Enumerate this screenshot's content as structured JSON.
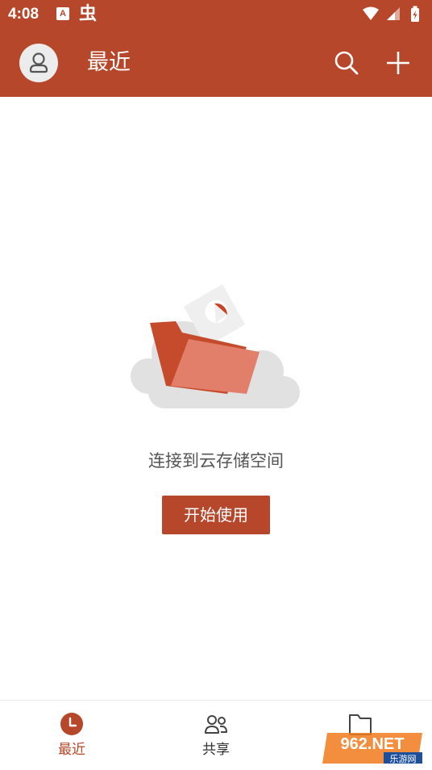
{
  "status_bar": {
    "time": "4:08",
    "notification_icons": [
      "a-icon",
      "bug-icon"
    ],
    "a_glyph": "A",
    "bug_glyph": "虫",
    "system_icons": [
      "wifi-icon",
      "cell-signal-icon",
      "battery-charging-icon"
    ]
  },
  "app_bar": {
    "title": "最近",
    "icons": [
      "avatar-icon",
      "search-icon",
      "add-icon"
    ]
  },
  "empty_state": {
    "illustration": "folder-cloud-illustration",
    "message": "连接到云存储空间",
    "button_label": "开始使用"
  },
  "bottom_nav": {
    "items": [
      {
        "label": "最近",
        "icon": "clock-icon",
        "active": true
      },
      {
        "label": "共享",
        "icon": "people-icon",
        "active": false
      },
      {
        "label": "",
        "icon": "folder-icon",
        "active": false
      }
    ]
  },
  "watermark": {
    "main": "962.NET",
    "sub": "乐游网"
  },
  "colors": {
    "accent": "#b7472a",
    "background": "#ffffff",
    "text_secondary": "#555555"
  }
}
